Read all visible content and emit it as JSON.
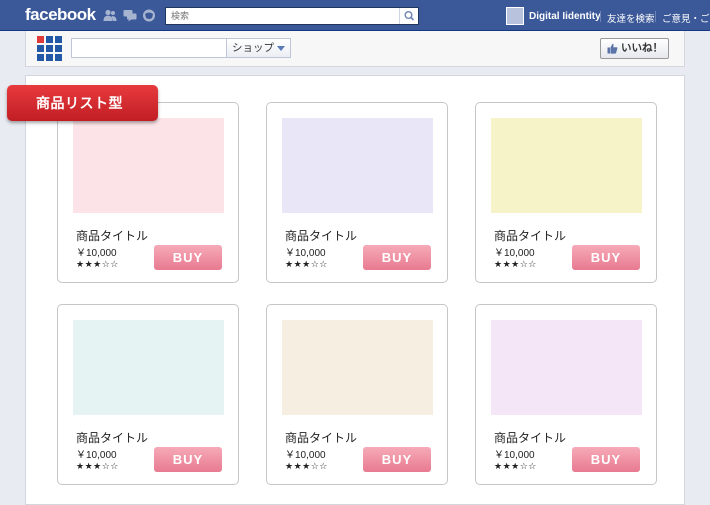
{
  "facebook_bar": {
    "logo_text": "facebook",
    "icons": [
      "friend-requests-icon",
      "messages-icon",
      "notifications-icon",
      "search-icon"
    ],
    "search_placeholder": "検索",
    "username": "Digital Iidentity",
    "links": [
      "友達を検索",
      "ご意見・ご"
    ]
  },
  "app_bar": {
    "logo_icon": "app-logo-icon",
    "search_value": "",
    "category_selected": "ショップ",
    "like_label": "いいね！"
  },
  "section": {
    "ribbon_label": "商品リスト型"
  },
  "products": [
    {
      "title": "商品タイトル",
      "price": "￥10,000",
      "rating": 3,
      "stars": "★★★☆☆",
      "buy_label": "BUY",
      "image_color": "#fbe3e8"
    },
    {
      "title": "商品タイトル",
      "price": "￥10,000",
      "rating": 3,
      "stars": "★★★☆☆",
      "buy_label": "BUY",
      "image_color": "#e9e6f8"
    },
    {
      "title": "商品タイトル",
      "price": "￥10,000",
      "rating": 3,
      "stars": "★★★☆☆",
      "buy_label": "BUY",
      "image_color": "#f6f3c9"
    },
    {
      "title": "商品タイトル",
      "price": "￥10,000",
      "rating": 3,
      "stars": "★★★☆☆",
      "buy_label": "BUY",
      "image_color": "#e6f3f3"
    },
    {
      "title": "商品タイトル",
      "price": "￥10,000",
      "rating": 3,
      "stars": "★★★☆☆",
      "buy_label": "BUY",
      "image_color": "#f6eee1"
    },
    {
      "title": "商品タイトル",
      "price": "￥10,000",
      "rating": 3,
      "stars": "★★★☆☆",
      "buy_label": "BUY",
      "image_color": "#f4e6f6"
    }
  ],
  "colors": {
    "facebook_blue": "#3b5998",
    "ribbon_red": "#d42a2f",
    "buy_pink": "#ef8ea1"
  }
}
